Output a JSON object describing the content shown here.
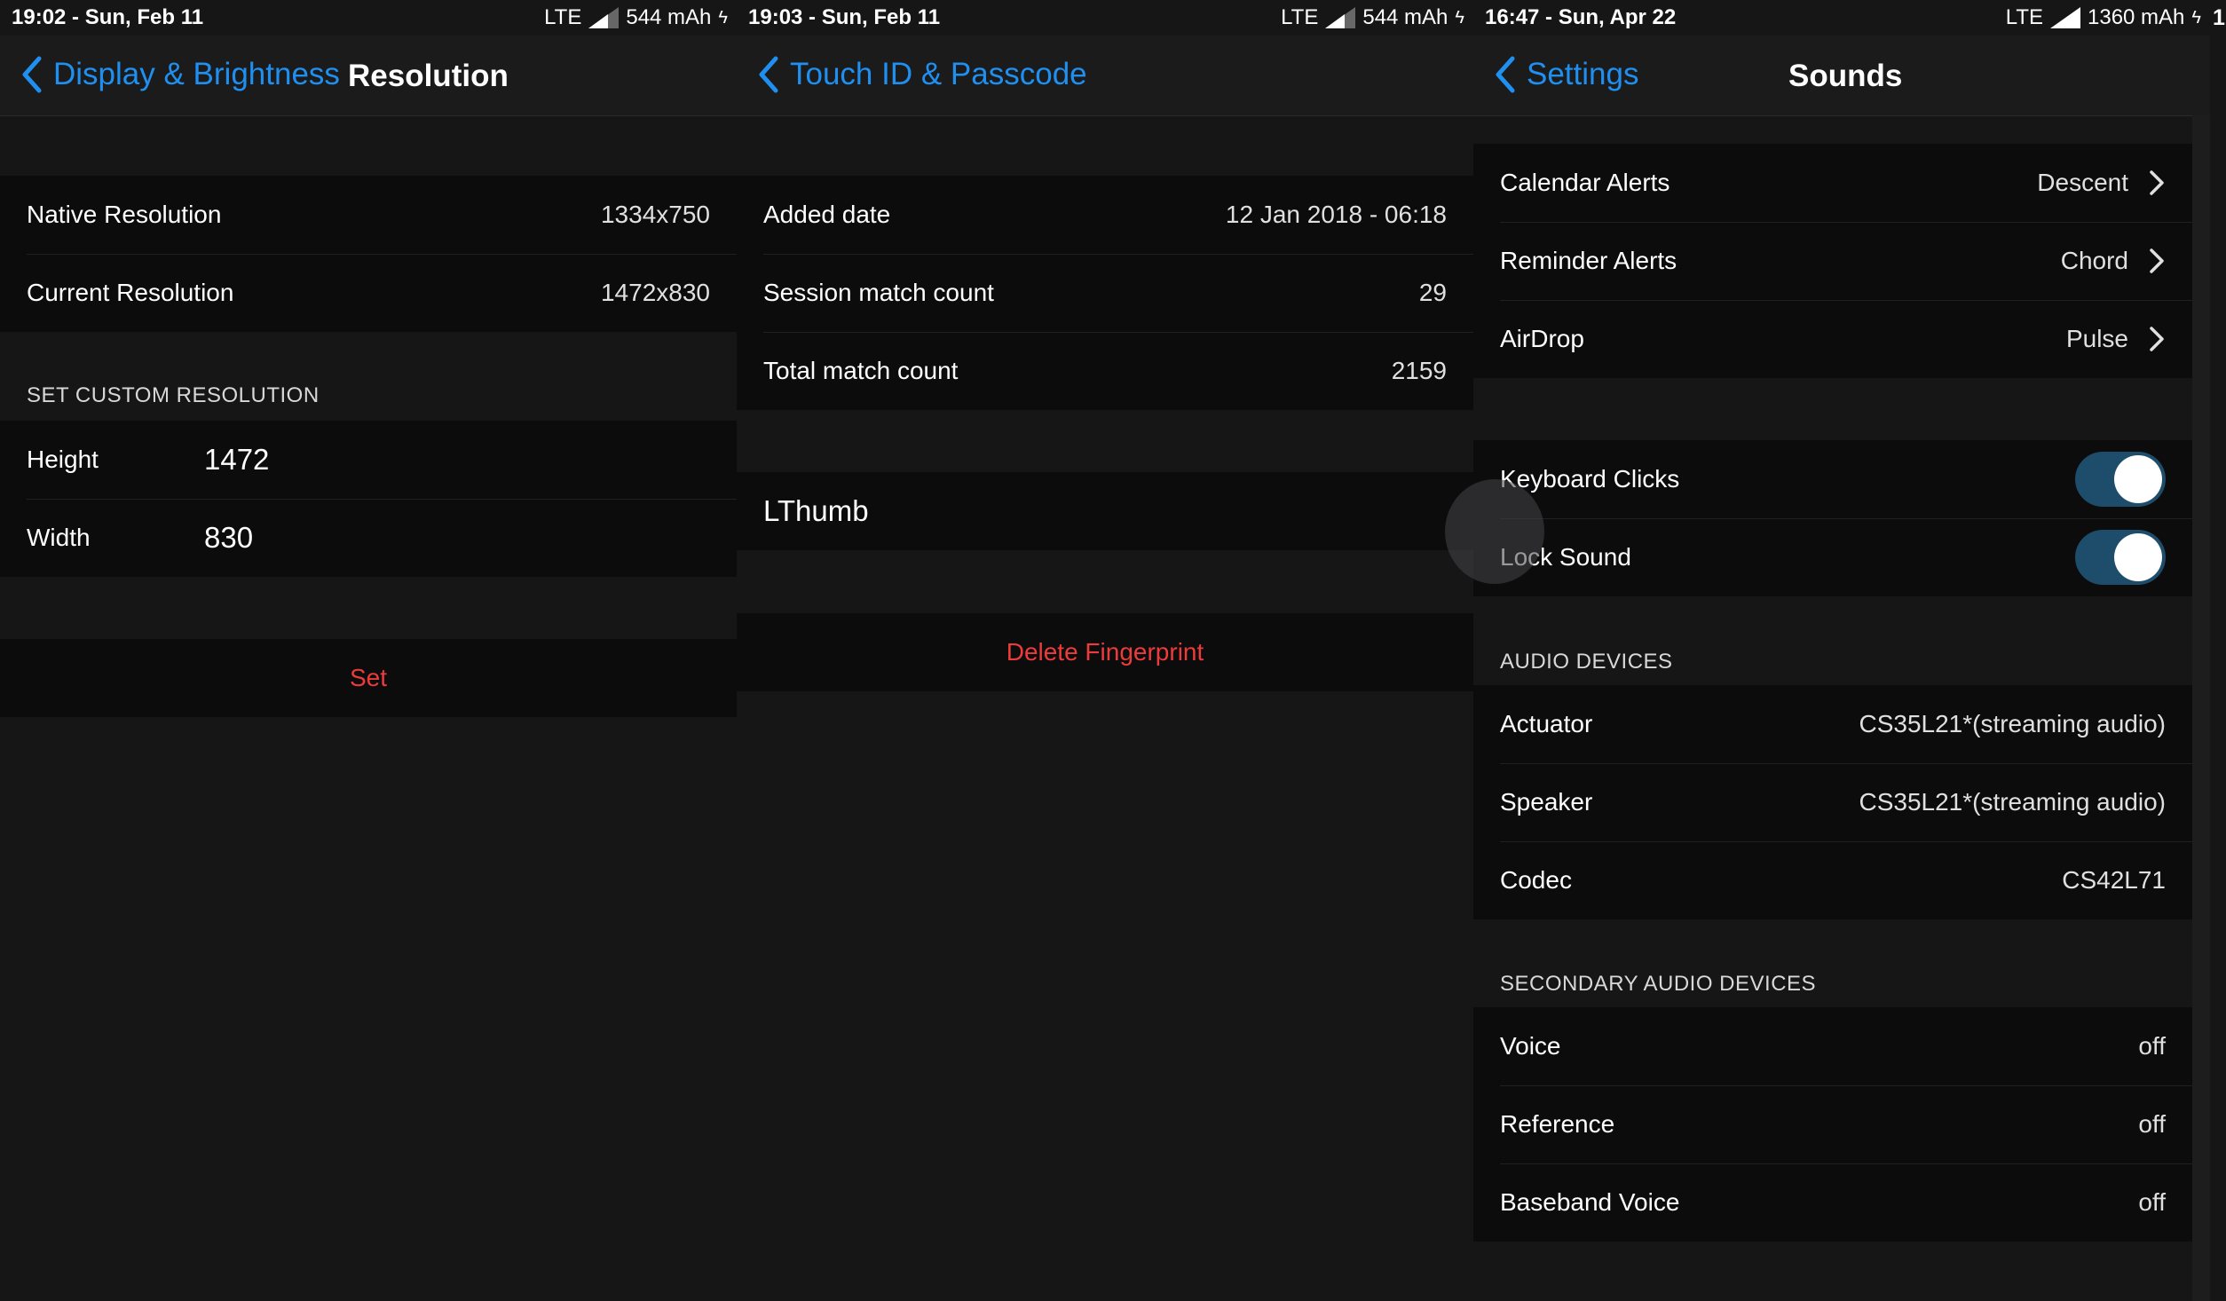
{
  "panel1": {
    "status": {
      "time": "19:02 - Sun, Feb 11",
      "network": "LTE",
      "battery": "544 mAh"
    },
    "nav": {
      "back_label": "Display & Brightness",
      "title": "Resolution"
    },
    "rows": [
      {
        "label": "Native Resolution",
        "value": "1334x750"
      },
      {
        "label": "Current Resolution",
        "value": "1472x830"
      }
    ],
    "custom_header": "SET CUSTOM RESOLUTION",
    "inputs": [
      {
        "label": "Height",
        "value": "1472"
      },
      {
        "label": "Width",
        "value": "830"
      }
    ],
    "set_button": "Set"
  },
  "panel2": {
    "status": {
      "time": "19:03 - Sun, Feb 11",
      "network": "LTE",
      "battery": "544 mAh"
    },
    "nav": {
      "back_label": "Touch ID & Passcode"
    },
    "rows": [
      {
        "label": "Added date",
        "value": "12 Jan 2018 - 06:18"
      },
      {
        "label": "Session match count",
        "value": "29"
      },
      {
        "label": "Total match count",
        "value": "2159"
      }
    ],
    "fingerprint_name": "LThumb",
    "delete_button": "Delete Fingerprint"
  },
  "panel3": {
    "status": {
      "time": "16:47 - Sun, Apr 22",
      "network": "LTE",
      "battery": "1360 mAh"
    },
    "nav": {
      "back_label": "Settings",
      "title": "Sounds"
    },
    "alerts": [
      {
        "label": "Calendar Alerts",
        "value": "Descent"
      },
      {
        "label": "Reminder Alerts",
        "value": "Chord"
      },
      {
        "label": "AirDrop",
        "value": "Pulse"
      }
    ],
    "toggles": [
      {
        "label": "Keyboard Clicks",
        "on": true
      },
      {
        "label": "Lock Sound",
        "on": true
      }
    ],
    "audio_header": "AUDIO DEVICES",
    "audio": [
      {
        "label": "Actuator",
        "value": "CS35L21*(streaming audio)"
      },
      {
        "label": "Speaker",
        "value": "CS35L21*(streaming audio)"
      },
      {
        "label": "Codec",
        "value": "CS42L71"
      }
    ],
    "secondary_header": "SECONDARY AUDIO DEVICES",
    "secondary": [
      {
        "label": "Voice",
        "value": "off"
      },
      {
        "label": "Reference",
        "value": "off"
      },
      {
        "label": "Baseband Voice",
        "value": "off"
      }
    ]
  },
  "strip": {
    "text": "1"
  },
  "colors": {
    "accent": "#1f8ff0",
    "destructive": "#ec3b3b",
    "toggle_on": "#1e4d6b",
    "background": "#161617",
    "cell": "#0c0c0c"
  }
}
